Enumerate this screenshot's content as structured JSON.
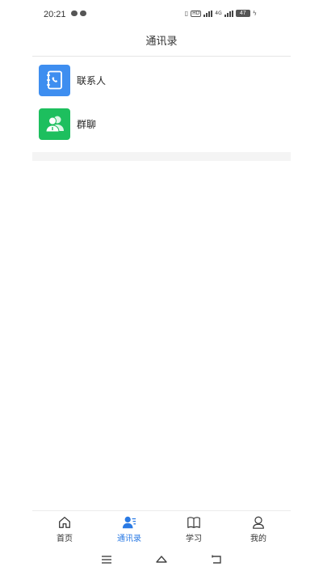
{
  "status_bar": {
    "time": "20:21",
    "hd_label": "HD",
    "network_label": "4G",
    "battery": "47"
  },
  "header": {
    "title": "通讯录"
  },
  "contacts_list": [
    {
      "label": "联系人",
      "icon": "contact-book-icon",
      "color": "#3e8ef0"
    },
    {
      "label": "群聊",
      "icon": "group-chat-icon",
      "color": "#1dbf5e"
    }
  ],
  "bottom_nav": [
    {
      "label": "首页",
      "icon": "home-icon",
      "active": false
    },
    {
      "label": "通讯录",
      "icon": "contacts-icon",
      "active": true
    },
    {
      "label": "学习",
      "icon": "book-icon",
      "active": false
    },
    {
      "label": "我的",
      "icon": "profile-icon",
      "active": false
    }
  ],
  "colors": {
    "accent": "#2a7ae4"
  },
  "system_nav": [
    "menu-icon",
    "home-icon",
    "back-icon"
  ]
}
